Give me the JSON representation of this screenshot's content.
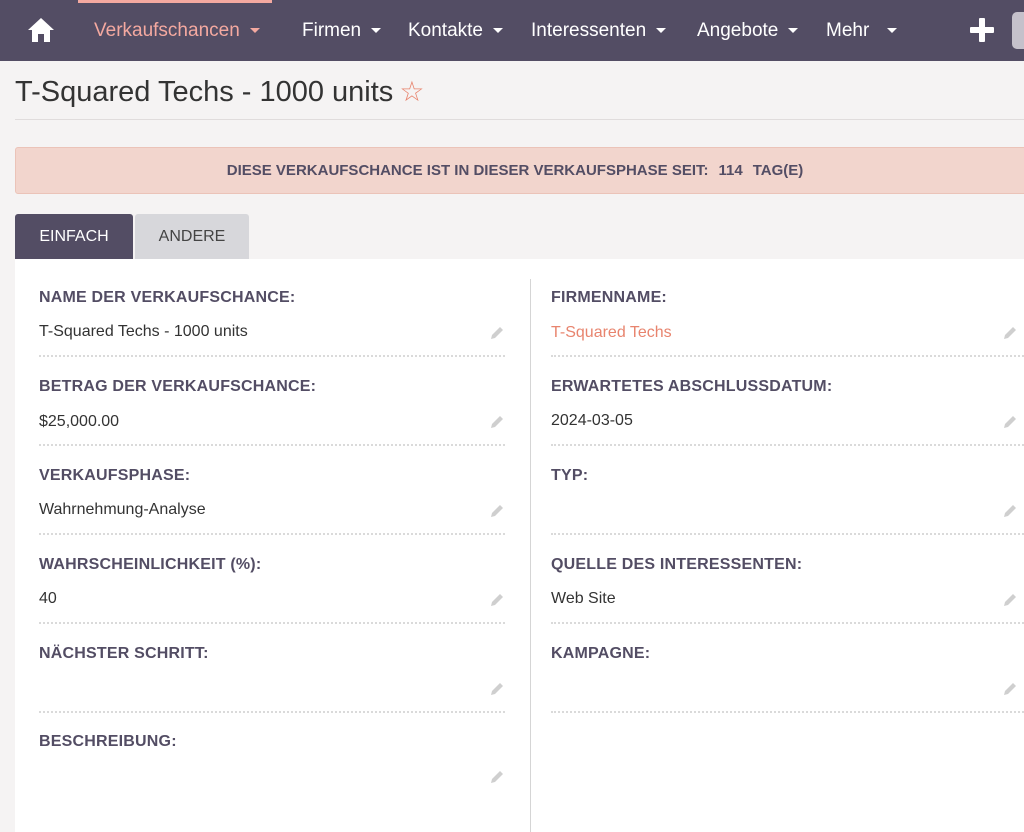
{
  "nav": {
    "home_icon": "home-icon",
    "items": [
      {
        "label": "Verkaufschancen",
        "active": true
      },
      {
        "label": "Firmen",
        "active": false
      },
      {
        "label": "Kontakte",
        "active": false
      },
      {
        "label": "Interessenten",
        "active": false
      },
      {
        "label": "Angebote",
        "active": false
      },
      {
        "label": "Mehr",
        "active": false
      }
    ],
    "create_icon": "plus-icon"
  },
  "record": {
    "title": "T-Squared Techs - 1000 units",
    "favorite_icon": "star-outline-icon"
  },
  "banner": {
    "text": "DIESE VERKAUFSCHANCE IST IN DIESER VERKAUFSPHASE SEIT:",
    "days": "114",
    "unit": "TAG(E)"
  },
  "tabs": [
    {
      "label": "EINFACH",
      "active": true
    },
    {
      "label": "ANDERE",
      "active": false
    }
  ],
  "fields": {
    "left": [
      {
        "label": "NAME DER VERKAUFSCHANCE:",
        "value": "T-Squared Techs - 1000 units"
      },
      {
        "label": "BETRAG DER VERKAUFSCHANCE:",
        "value": "$25,000.00"
      },
      {
        "label": "VERKAUFSPHASE:",
        "value": "Wahrnehmung-Analyse"
      },
      {
        "label": "WAHRSCHEINLICHKEIT (%):",
        "value": "40"
      },
      {
        "label": "NÄCHSTER SCHRITT:",
        "value": ""
      },
      {
        "label": "BESCHREIBUNG:",
        "value": ""
      }
    ],
    "right": [
      {
        "label": "FIRMENNAME:",
        "value": "T-Squared Techs",
        "link": true
      },
      {
        "label": "ERWARTETES ABSCHLUSSDATUM:",
        "value": "2024-03-05"
      },
      {
        "label": "TYP:",
        "value": ""
      },
      {
        "label": "QUELLE DES INTERESSENTEN:",
        "value": "Web Site"
      },
      {
        "label": "KAMPAGNE:",
        "value": ""
      }
    ]
  },
  "edit_icon": "pencil-icon",
  "colors": {
    "nav_bg": "#534d64",
    "accent": "#e8846e",
    "banner_bg": "#f2d5cd"
  }
}
